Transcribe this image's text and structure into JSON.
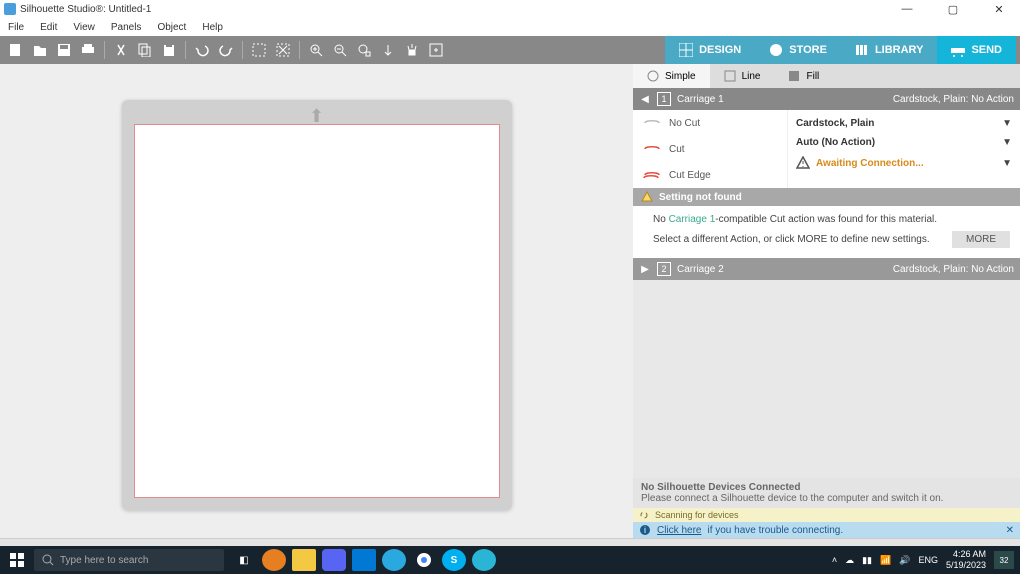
{
  "title": "Silhouette Studio®: Untitled-1",
  "menus": [
    "File",
    "Edit",
    "View",
    "Panels",
    "Object",
    "Help"
  ],
  "right_tabs": {
    "design": "DESIGN",
    "store": "STORE",
    "library": "LIBRARY",
    "send": "SEND"
  },
  "modes": {
    "simple": "Simple",
    "line": "Line",
    "fill": "Fill"
  },
  "carriage1": {
    "title": "Carriage 1",
    "status": "Cardstock, Plain: No Action",
    "opts": {
      "nocut": "No Cut",
      "cut": "Cut",
      "cutedge": "Cut Edge"
    },
    "material": "Cardstock, Plain",
    "action": "Auto (No Action)",
    "connect": "Awaiting Connection..."
  },
  "carriage2": {
    "title": "Carriage 2",
    "status": "Cardstock, Plain: No Action"
  },
  "setting_warn": "Setting not found",
  "setting_prefix": "No ",
  "setting_carriage": "Carriage 1",
  "setting_suffix": "-compatible Cut action was found for this material.",
  "setting_msg2": "Select a different Action, or click MORE to define new settings.",
  "more": "MORE",
  "footer": {
    "line1": "No Silhouette Devices Connected",
    "line2": "Please connect a Silhouette device to the computer and switch it on."
  },
  "scanning": "Scanning for devices",
  "help_link": "Click here",
  "help_text": " if you have trouble connecting.",
  "search_placeholder": "Type here to search",
  "lang": "ENG",
  "time": "4:26 AM",
  "date": "5/19/2023",
  "notif_count": "32"
}
